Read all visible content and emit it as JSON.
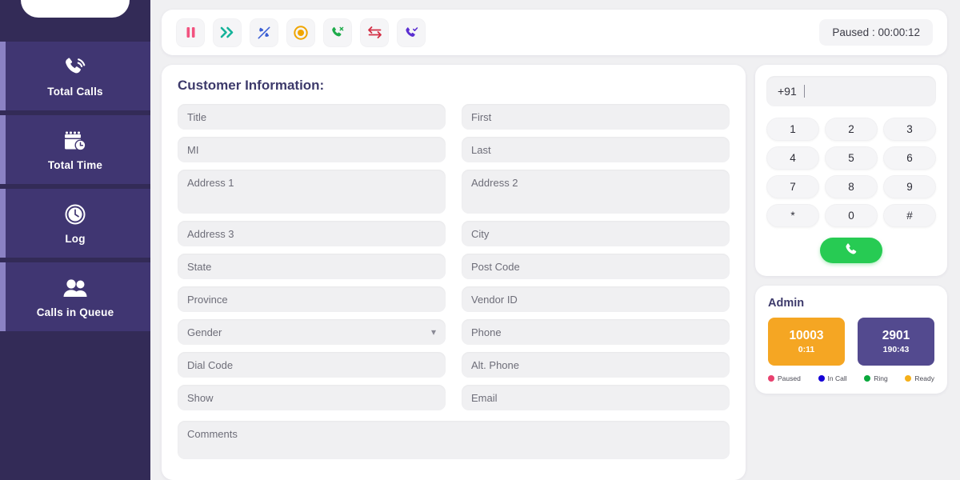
{
  "sidebar": {
    "items": [
      {
        "label": "Total Calls",
        "icon": "phone-signal-icon"
      },
      {
        "label": "Total Time",
        "icon": "calendar-clock-icon"
      },
      {
        "label": "Log",
        "icon": "clock-icon"
      },
      {
        "label": "Calls in Queue",
        "icon": "users-icon"
      }
    ]
  },
  "toolbar": {
    "buttons": [
      {
        "name": "pause-button",
        "icon": "pause-icon",
        "color": "#f2527f"
      },
      {
        "name": "forward-button",
        "icon": "double-chevron-right-icon",
        "color": "#15b39a"
      },
      {
        "name": "hold-call-button",
        "icon": "phone-slash-icon",
        "color": "#3b5fd4"
      },
      {
        "name": "record-button",
        "icon": "record-circle-icon",
        "color": "#f0a500"
      },
      {
        "name": "end-call-button",
        "icon": "phone-x-icon",
        "color": "#1dab4a"
      },
      {
        "name": "transfer-button",
        "icon": "swap-arrows-icon",
        "color": "#d32f45"
      },
      {
        "name": "answer-call-button",
        "icon": "phone-check-icon",
        "color": "#5b2fd1"
      }
    ],
    "status": "Paused : 00:00:12"
  },
  "form": {
    "title": "Customer Information:",
    "fields": [
      {
        "placeholder": "Title",
        "name": "title-field",
        "type": "input"
      },
      {
        "placeholder": "First",
        "name": "first-name-field",
        "type": "input"
      },
      {
        "placeholder": "MI",
        "name": "middle-initial-field",
        "type": "input"
      },
      {
        "placeholder": "Last",
        "name": "last-name-field",
        "type": "input"
      },
      {
        "placeholder": "Address 1",
        "name": "address-1-field",
        "type": "textarea"
      },
      {
        "placeholder": "Address 2",
        "name": "address-2-field",
        "type": "textarea"
      },
      {
        "placeholder": "Address 3",
        "name": "address-3-field",
        "type": "input"
      },
      {
        "placeholder": "City",
        "name": "city-field",
        "type": "input"
      },
      {
        "placeholder": "State",
        "name": "state-field",
        "type": "input"
      },
      {
        "placeholder": "Post Code",
        "name": "post-code-field",
        "type": "input"
      },
      {
        "placeholder": "Province",
        "name": "province-field",
        "type": "input"
      },
      {
        "placeholder": "Vendor  ID",
        "name": "vendor-id-field",
        "type": "input"
      },
      {
        "placeholder": "Gender",
        "name": "gender-select",
        "type": "select"
      },
      {
        "placeholder": "Phone",
        "name": "phone-field",
        "type": "input"
      },
      {
        "placeholder": "Dial Code",
        "name": "dial-code-field",
        "type": "input"
      },
      {
        "placeholder": "Alt. Phone",
        "name": "alt-phone-field",
        "type": "input"
      },
      {
        "placeholder": "Show",
        "name": "show-field",
        "type": "input"
      },
      {
        "placeholder": "Email",
        "name": "email-field",
        "type": "input"
      }
    ],
    "comments_placeholder": "Comments"
  },
  "dialer": {
    "number": "+91",
    "keys": [
      "1",
      "2",
      "3",
      "4",
      "5",
      "6",
      "7",
      "8",
      "9",
      "*",
      "0",
      "#"
    ],
    "call_icon": "phone-icon",
    "call_color": "#27cb53"
  },
  "admin": {
    "title": "Admin",
    "agents": [
      {
        "id": "10003",
        "time": "0:11",
        "color": "#f5a623"
      },
      {
        "id": "2901",
        "time": "190:43",
        "color": "#534a8f"
      }
    ],
    "legend": [
      {
        "label": "Paused",
        "color": "#e8416f"
      },
      {
        "label": "In Call",
        "color": "#1500d6"
      },
      {
        "label": "Ring",
        "color": "#0aa83c"
      },
      {
        "label": "Ready",
        "color": "#f5b01a"
      }
    ]
  }
}
